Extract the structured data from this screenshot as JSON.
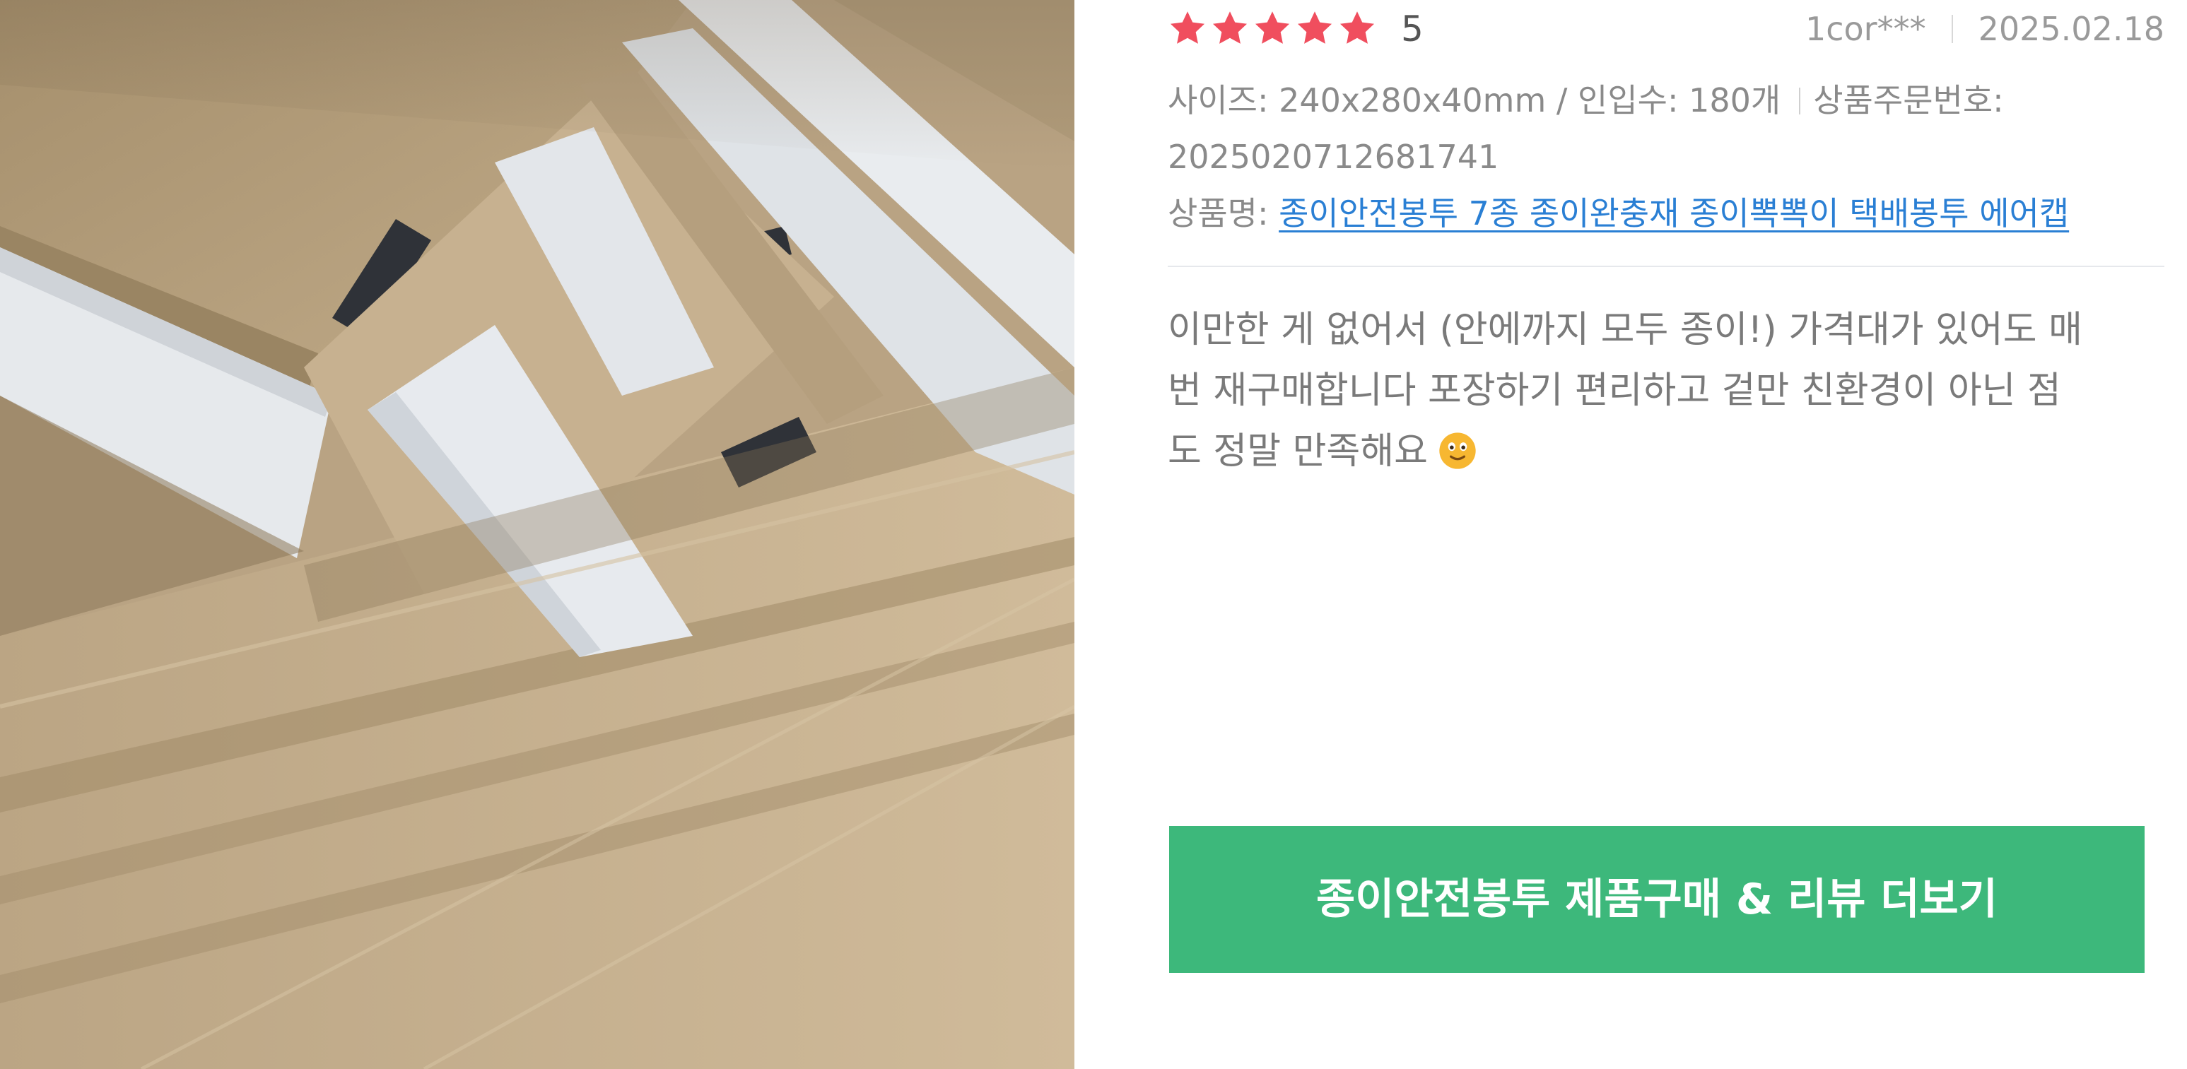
{
  "review": {
    "rating": {
      "stars_filled": 5,
      "stars_total": 5,
      "score_text": "5"
    },
    "author": "1cor***",
    "date": "2025.02.18",
    "size_info": "사이즈: 240x280x40mm / 인입수: 180개",
    "order_label": "상품주문번호:",
    "order_number": "2025020712681741",
    "product_label": "상품명:",
    "product_name": "종이안전봉투 7종 종이완충재 종이뽁뽁이 택배봉투 에어캡",
    "body_lines": [
      "이만한 게 없어서 (안에까지 모두 종이!) 가격대가 있어도 매",
      "번 재구매합니다 포장하기 편리하고 겉만 친환경이 아닌 점",
      "도 정말 만족해요"
    ],
    "emoji": "slightly-smiling-face",
    "photo": "kraft-paper-envelopes-photo"
  },
  "cta": {
    "label": "종이안전봉투 제품구매 & 리뷰 더보기"
  },
  "colors": {
    "star": "#f04e5e",
    "link": "#2a7fd4",
    "cta_bg": "#3db87b",
    "cta_text": "#ffffff",
    "emoji": "#f7b731"
  }
}
